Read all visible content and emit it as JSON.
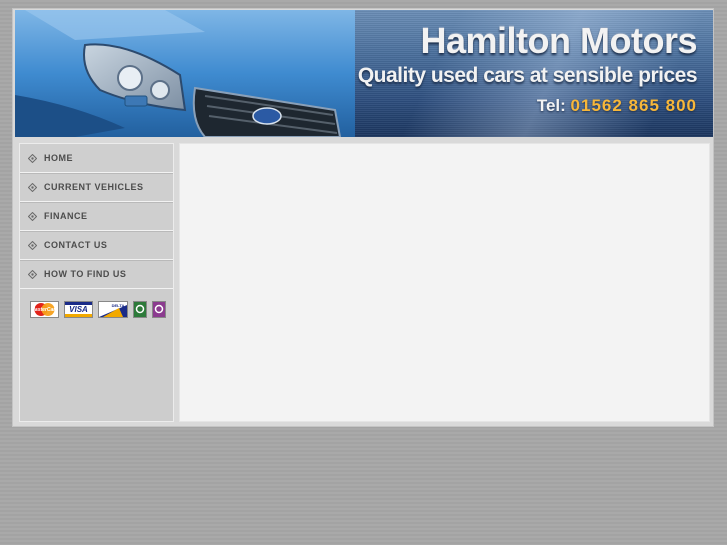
{
  "header": {
    "title": "Hamilton Motors",
    "tagline": "Quality used cars at sensible prices",
    "phone_label": "Tel:",
    "phone_number": "01562 865 800"
  },
  "nav": {
    "items": [
      {
        "label": "HOME",
        "icon": "diamond-bullet-icon"
      },
      {
        "label": "CURRENT VEHICLES",
        "icon": "diamond-bullet-icon"
      },
      {
        "label": "FINANCE",
        "icon": "diamond-bullet-icon"
      },
      {
        "label": "CONTACT US",
        "icon": "diamond-bullet-icon"
      },
      {
        "label": "HOW TO FIND US",
        "icon": "diamond-bullet-icon"
      }
    ]
  },
  "payment_cards": {
    "mastercard": "MasterCard",
    "visa": "VISA",
    "delta": "DELTA",
    "icons": [
      "mastercard-logo",
      "visa-logo",
      "delta-logo",
      "maestro-logo",
      "solo-logo"
    ]
  },
  "colors": {
    "accent_phone": "#f7b73a",
    "banner_blue": "#2e4f7f",
    "page_bg": "#a8a8a8"
  }
}
